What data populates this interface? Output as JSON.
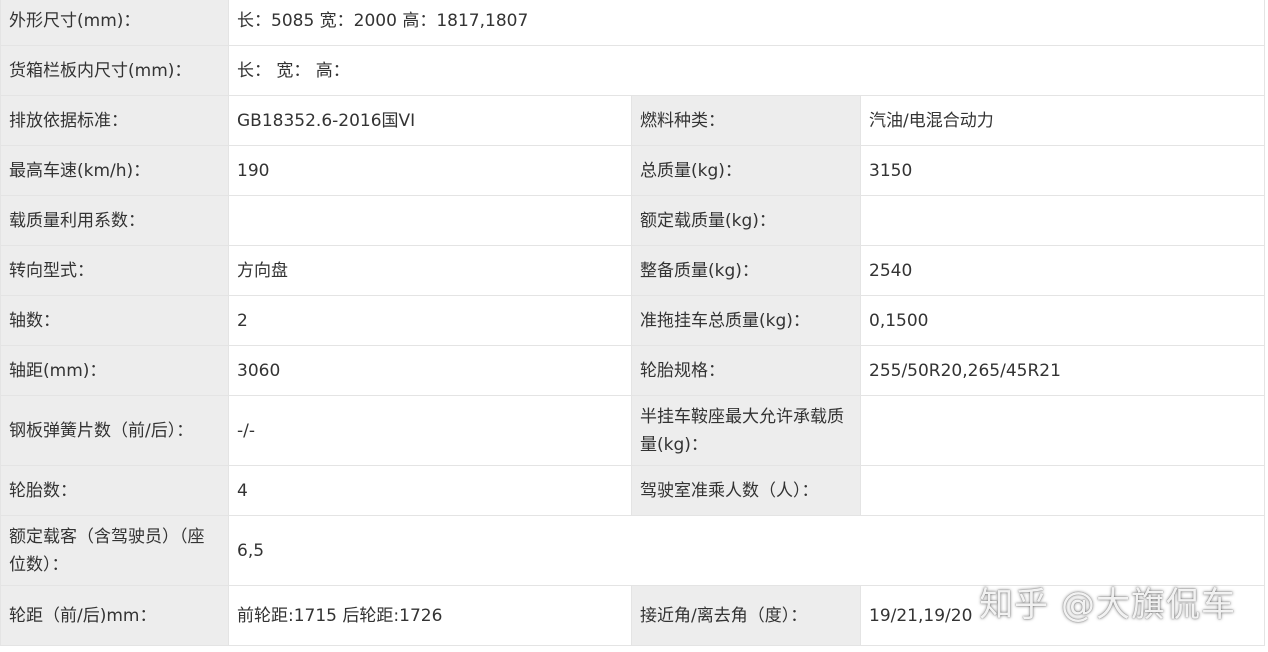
{
  "rows": [
    {
      "label": "外形尺寸(mm)：",
      "value": "长：5085 宽：2000 高：1817,1807"
    },
    {
      "label": "货箱栏板内尺寸(mm)：",
      "value": "长： 宽： 高："
    },
    {
      "label": "排放依据标准：",
      "value": "GB18352.6-2016国VI",
      "label2": "燃料种类：",
      "value2": "汽油/电混合动力"
    },
    {
      "label": "最高车速(km/h)：",
      "value": "190",
      "label2": "总质量(kg)：",
      "value2": "3150"
    },
    {
      "label": "载质量利用系数：",
      "value": "",
      "label2": "额定载质量(kg)：",
      "value2": ""
    },
    {
      "label": "转向型式：",
      "value": "方向盘",
      "label2": "整备质量(kg)：",
      "value2": "2540"
    },
    {
      "label": "轴数：",
      "value": "2",
      "label2": "准拖挂车总质量(kg)：",
      "value2": "0,1500"
    },
    {
      "label": "轴距(mm)：",
      "value": "3060",
      "label2": "轮胎规格：",
      "value2": "255/50R20,265/45R21"
    },
    {
      "label": "钢板弹簧片数（前/后）：",
      "value": "-/-",
      "label2": "半挂车鞍座最大允许承载质量(kg)：",
      "value2": ""
    },
    {
      "label": "轮胎数：",
      "value": "4",
      "label2": "驾驶室准乘人数（人）：",
      "value2": ""
    },
    {
      "label": "额定载客（含驾驶员）（座位数）：",
      "value": "6,5"
    },
    {
      "label": "轮距（前/后)mm：",
      "value": "前轮距:1715 后轮距:1726",
      "label2": "接近角/离去角（度）：",
      "value2": "19/21,19/20"
    }
  ],
  "watermark": "知乎 @大旗侃车",
  "colors": {
    "label_bg": "#ededed",
    "value_bg": "#ffffff",
    "border": "#e4e4e4",
    "text": "#333333"
  }
}
